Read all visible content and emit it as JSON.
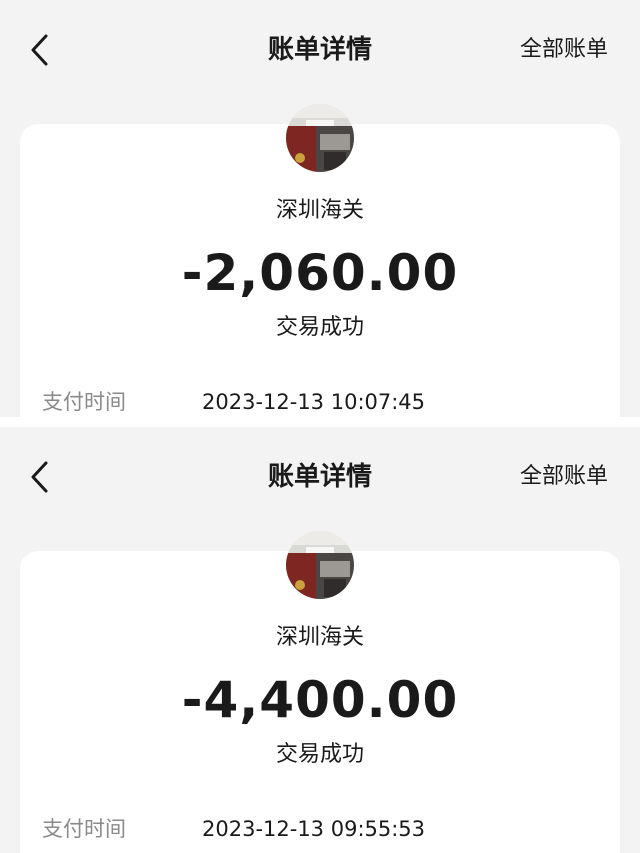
{
  "colors": {
    "page_background": "#f3f3f3",
    "card_background": "#ffffff",
    "text_primary": "#1a1a1a",
    "text_secondary": "#8a8a8a"
  },
  "bills": [
    {
      "nav": {
        "back_icon": "chevron-left-icon",
        "title": "账单详情",
        "all_bills_label": "全部账单"
      },
      "merchant": {
        "avatar_icon": "merchant-avatar",
        "name": "深圳海关"
      },
      "amount": "-2,060.00",
      "status": "交易成功",
      "details": {
        "payment_time_label": "支付时间",
        "payment_time_value": "2023-12-13 10:07:45"
      }
    },
    {
      "nav": {
        "back_icon": "chevron-left-icon",
        "title": "账单详情",
        "all_bills_label": "全部账单"
      },
      "merchant": {
        "avatar_icon": "merchant-avatar",
        "name": "深圳海关"
      },
      "amount": "-4,400.00",
      "status": "交易成功",
      "details": {
        "payment_time_label": "支付时间",
        "payment_time_value": "2023-12-13 09:55:53"
      }
    }
  ]
}
